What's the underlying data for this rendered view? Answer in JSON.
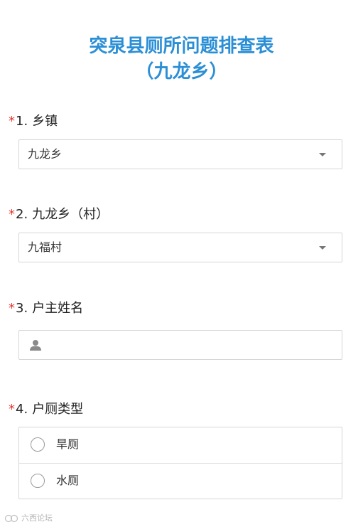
{
  "form": {
    "title_line_1": "突泉县厕所问题排查表",
    "title_line_2": "（九龙乡）"
  },
  "questions": [
    {
      "required_mark": "*",
      "number": "1.",
      "label": "乡镇",
      "type": "select",
      "value": "九龙乡"
    },
    {
      "required_mark": "*",
      "number": "2.",
      "label": "九龙乡（村）",
      "type": "select",
      "value": "九福村"
    },
    {
      "required_mark": "*",
      "number": "3.",
      "label": "户主姓名",
      "type": "text",
      "value": "",
      "icon": "person-icon"
    },
    {
      "required_mark": "*",
      "number": "4.",
      "label": "户厕类型",
      "type": "radio",
      "options": [
        "旱厕",
        "水厕"
      ]
    }
  ],
  "watermark": {
    "text": "六西论坛"
  },
  "colors": {
    "title": "#2b8fd6",
    "required": "#e53935",
    "border": "#d6d6d6"
  }
}
